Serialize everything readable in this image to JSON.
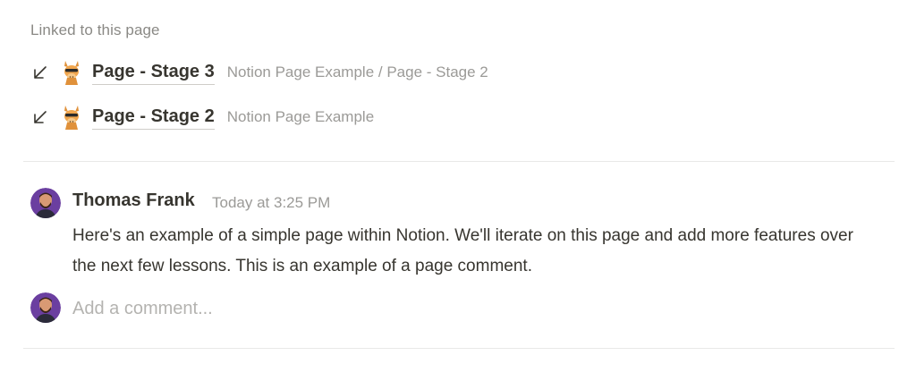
{
  "linked_section": {
    "heading": "Linked to this page",
    "items": [
      {
        "title": "Page - Stage 3",
        "path": "Notion Page Example / Page - Stage 2",
        "arrow_icon": "arrow-down-left-icon",
        "page_icon": "llama-emoji-icon"
      },
      {
        "title": "Page - Stage 2",
        "path": "Notion Page Example",
        "arrow_icon": "arrow-down-left-icon",
        "page_icon": "llama-emoji-icon"
      }
    ]
  },
  "comment": {
    "author": "Thomas Frank",
    "timestamp": "Today at 3:25 PM",
    "body": "Here's an example of a simple page within Notion. We'll iterate on this page and add more features over the next few lessons. This is an example of a page comment.",
    "avatar_icon": "user-avatar"
  },
  "new_comment": {
    "placeholder": "Add a comment...",
    "value": ""
  },
  "colors": {
    "text": "#37352f",
    "muted": "#9b9a97",
    "divider": "#e9e9e7",
    "avatar_bg": "#6b3fa0"
  }
}
